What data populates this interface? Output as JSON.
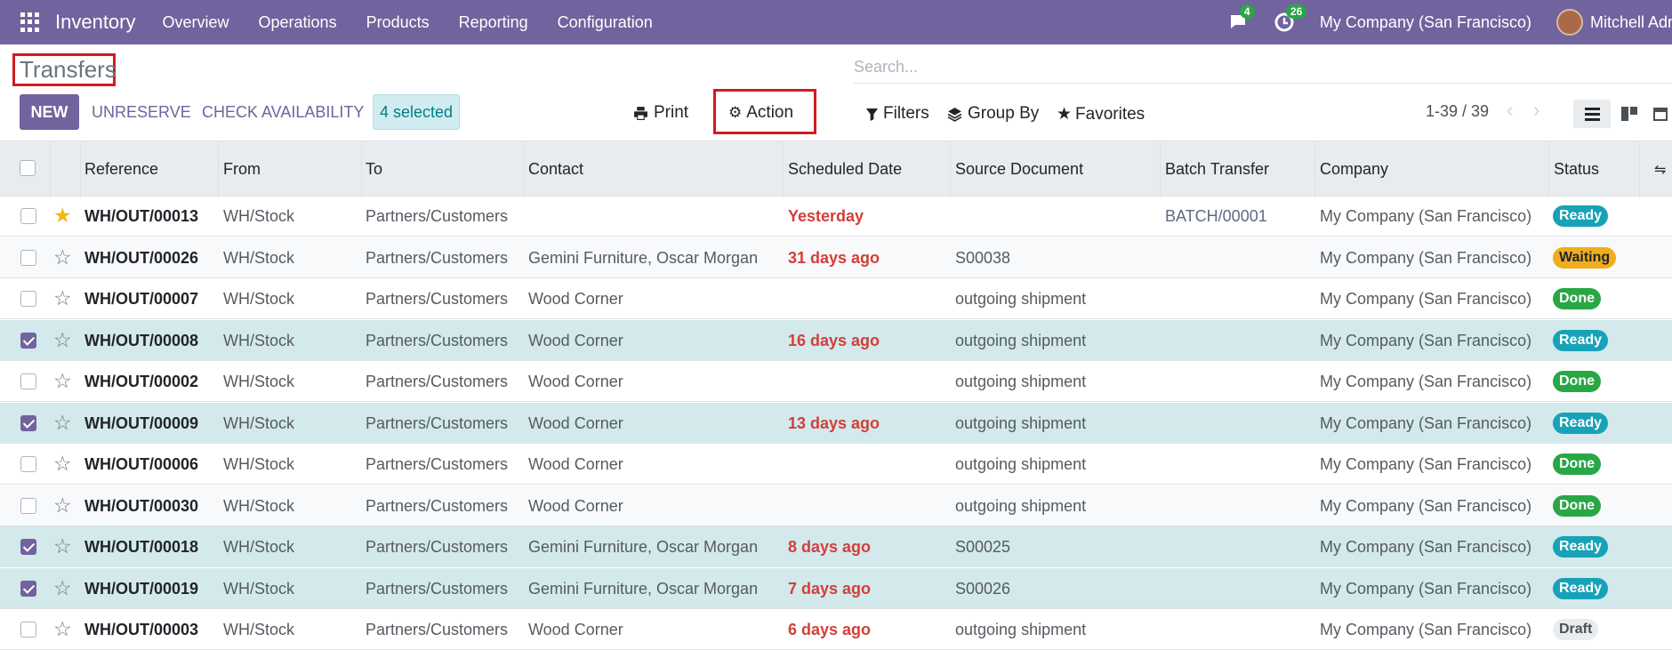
{
  "topbar": {
    "app_name": "Inventory",
    "menu": [
      "Overview",
      "Operations",
      "Products",
      "Reporting",
      "Configuration"
    ],
    "messages_count": "4",
    "activities_count": "26",
    "company": "My Company (San Francisco)",
    "user": "Mitchell Admin"
  },
  "page": {
    "title": "Transfers",
    "search_placeholder": "Search..."
  },
  "toolbar": {
    "new": "NEW",
    "unreserve": "UNRESERVE",
    "check_availability": "CHECK AVAILABILITY",
    "selected": "4 selected",
    "print": "Print",
    "action": "Action",
    "filters": "Filters",
    "group_by": "Group By",
    "favorites": "Favorites",
    "pager": "1-39 / 39"
  },
  "columns": [
    "Reference",
    "From",
    "To",
    "Contact",
    "Scheduled Date",
    "Source Document",
    "Batch Transfer",
    "Company",
    "Status"
  ],
  "rows": [
    {
      "checked": false,
      "fav": true,
      "ref": "WH/OUT/00013",
      "from": "WH/Stock",
      "to": "Partners/Customers",
      "contact": "",
      "date": "Yesterday",
      "source": "",
      "batch": "BATCH/00001",
      "company": "My Company (San Francisco)",
      "status": "Ready",
      "status_type": "ready"
    },
    {
      "checked": false,
      "fav": false,
      "ref": "WH/OUT/00026",
      "from": "WH/Stock",
      "to": "Partners/Customers",
      "contact": "Gemini Furniture, Oscar Morgan",
      "date": "31 days ago",
      "source": "S00038",
      "batch": "",
      "company": "My Company (San Francisco)",
      "status": "Waiting",
      "status_type": "waiting"
    },
    {
      "checked": false,
      "fav": false,
      "ref": "WH/OUT/00007",
      "from": "WH/Stock",
      "to": "Partners/Customers",
      "contact": "Wood Corner",
      "date": "",
      "source": "outgoing shipment",
      "batch": "",
      "company": "My Company (San Francisco)",
      "status": "Done",
      "status_type": "done"
    },
    {
      "checked": true,
      "fav": false,
      "ref": "WH/OUT/00008",
      "from": "WH/Stock",
      "to": "Partners/Customers",
      "contact": "Wood Corner",
      "date": "16 days ago",
      "source": "outgoing shipment",
      "batch": "",
      "company": "My Company (San Francisco)",
      "status": "Ready",
      "status_type": "ready"
    },
    {
      "checked": false,
      "fav": false,
      "ref": "WH/OUT/00002",
      "from": "WH/Stock",
      "to": "Partners/Customers",
      "contact": "Wood Corner",
      "date": "",
      "source": "outgoing shipment",
      "batch": "",
      "company": "My Company (San Francisco)",
      "status": "Done",
      "status_type": "done"
    },
    {
      "checked": true,
      "fav": false,
      "ref": "WH/OUT/00009",
      "from": "WH/Stock",
      "to": "Partners/Customers",
      "contact": "Wood Corner",
      "date": "13 days ago",
      "source": "outgoing shipment",
      "batch": "",
      "company": "My Company (San Francisco)",
      "status": "Ready",
      "status_type": "ready"
    },
    {
      "checked": false,
      "fav": false,
      "ref": "WH/OUT/00006",
      "from": "WH/Stock",
      "to": "Partners/Customers",
      "contact": "Wood Corner",
      "date": "",
      "source": "outgoing shipment",
      "batch": "",
      "company": "My Company (San Francisco)",
      "status": "Done",
      "status_type": "done"
    },
    {
      "checked": false,
      "fav": false,
      "ref": "WH/OUT/00030",
      "from": "WH/Stock",
      "to": "Partners/Customers",
      "contact": "Wood Corner",
      "date": "",
      "source": "outgoing shipment",
      "batch": "",
      "company": "My Company (San Francisco)",
      "status": "Done",
      "status_type": "done"
    },
    {
      "checked": true,
      "fav": false,
      "ref": "WH/OUT/00018",
      "from": "WH/Stock",
      "to": "Partners/Customers",
      "contact": "Gemini Furniture, Oscar Morgan",
      "date": "8 days ago",
      "source": "S00025",
      "batch": "",
      "company": "My Company (San Francisco)",
      "status": "Ready",
      "status_type": "ready"
    },
    {
      "checked": true,
      "fav": false,
      "ref": "WH/OUT/00019",
      "from": "WH/Stock",
      "to": "Partners/Customers",
      "contact": "Gemini Furniture, Oscar Morgan",
      "date": "7 days ago",
      "source": "S00026",
      "batch": "",
      "company": "My Company (San Francisco)",
      "status": "Ready",
      "status_type": "ready"
    },
    {
      "checked": false,
      "fav": false,
      "ref": "WH/OUT/00003",
      "from": "WH/Stock",
      "to": "Partners/Customers",
      "contact": "Wood Corner",
      "date": "6 days ago",
      "source": "outgoing shipment",
      "batch": "",
      "company": "My Company (San Francisco)",
      "status": "Draft",
      "status_type": "draft"
    }
  ]
}
